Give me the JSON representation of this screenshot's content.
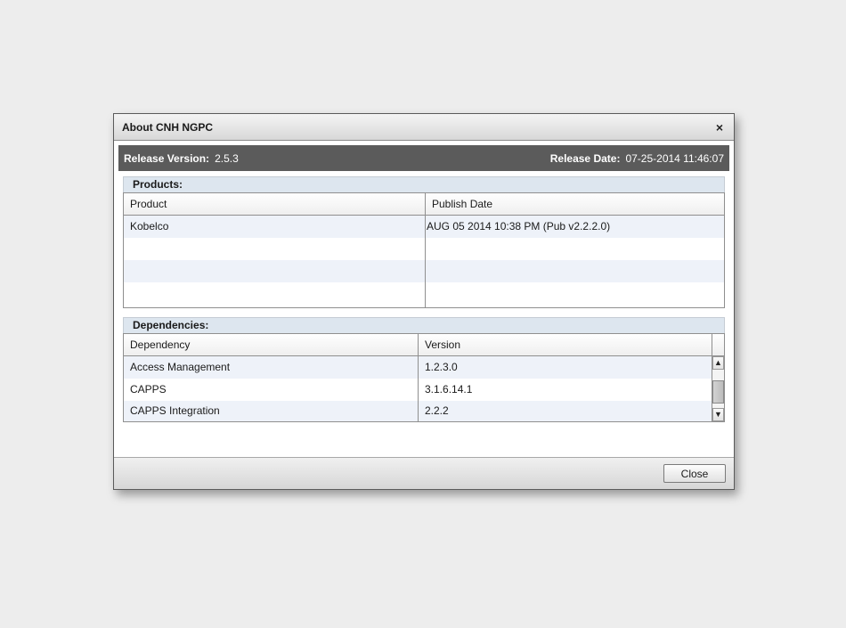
{
  "dialog": {
    "title": "About CNH NGPC",
    "close_glyph": "×"
  },
  "release": {
    "version_label": "Release Version:",
    "version_value": "2.5.3",
    "date_label": "Release Date:",
    "date_value": "07-25-2014 11:46:07"
  },
  "products": {
    "header": "Products:",
    "columns": [
      "Product",
      "Publish Date"
    ],
    "rows": [
      [
        "Kobelco",
        "AUG 05 2014 10:38 PM (Pub v2.2.2.0)"
      ],
      [
        "",
        ""
      ],
      [
        "",
        ""
      ],
      [
        "",
        ""
      ]
    ]
  },
  "dependencies": {
    "header": "Dependencies:",
    "columns": [
      "Dependency",
      "Version"
    ],
    "rows": [
      [
        "Access Management",
        "1.2.3.0"
      ],
      [
        "CAPPS",
        "3.1.6.14.1"
      ],
      [
        "CAPPS Integration",
        "2.2.2"
      ]
    ],
    "scroll_up_glyph": "▲",
    "scroll_down_glyph": "▼"
  },
  "footer": {
    "close_label": "Close"
  }
}
